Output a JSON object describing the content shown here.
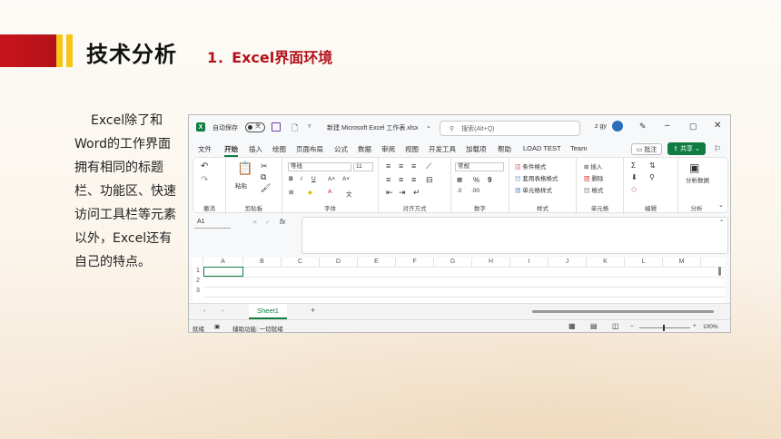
{
  "slide": {
    "title": "技术分析",
    "subtitle": "1．Excel界面环境",
    "body": "Excel除了和Word的工作界面拥有相同的标题栏、功能区、快速访问工具栏等元素以外，Excel还有自己的特点。"
  },
  "excel": {
    "autosave_label": "自动保存",
    "autosave_state": "关",
    "filename": "新建 Microsoft Excel 工作表.xlsx",
    "search_placeholder": "搜索(Alt+Q)",
    "user": "z gy",
    "tabs": [
      "文件",
      "开始",
      "插入",
      "绘图",
      "页面布局",
      "公式",
      "数据",
      "审阅",
      "视图",
      "开发工具",
      "加载项",
      "帮助",
      "LOAD TEST",
      "Team"
    ],
    "comment_label": "批注",
    "share_label": "共享",
    "ribbon": {
      "undo_label": "撤消",
      "paste_label": "粘贴",
      "clipboard_label": "剪贴板",
      "font_name": "等线",
      "font_size": "11",
      "font_label": "字体",
      "align_label": "对齐方式",
      "number_format": "常规",
      "number_label": "数字",
      "cond_format": "条件格式",
      "table_format": "套用表格格式",
      "cell_style": "单元格样式",
      "style_label": "样式",
      "insert_label": "插入",
      "delete_label": "删除",
      "format_label": "格式",
      "cells_label": "单元格",
      "edit_label": "编辑",
      "analyze_label": "分析数据",
      "analyze_group": "分析"
    },
    "namebox": "A1",
    "columns": [
      "A",
      "B",
      "C",
      "D",
      "E",
      "F",
      "G",
      "H",
      "I",
      "J",
      "K",
      "L",
      "M"
    ],
    "rows": [
      "1",
      "2",
      "3"
    ],
    "sheet_tab": "Sheet1",
    "status_ready": "就绪",
    "accessibility": "辅助功能: 一切就绪",
    "zoom": "100%",
    "colors": {
      "accent": "#107c41",
      "slide_red": "#c8141a",
      "slide_yellow": "#f5c518"
    }
  }
}
